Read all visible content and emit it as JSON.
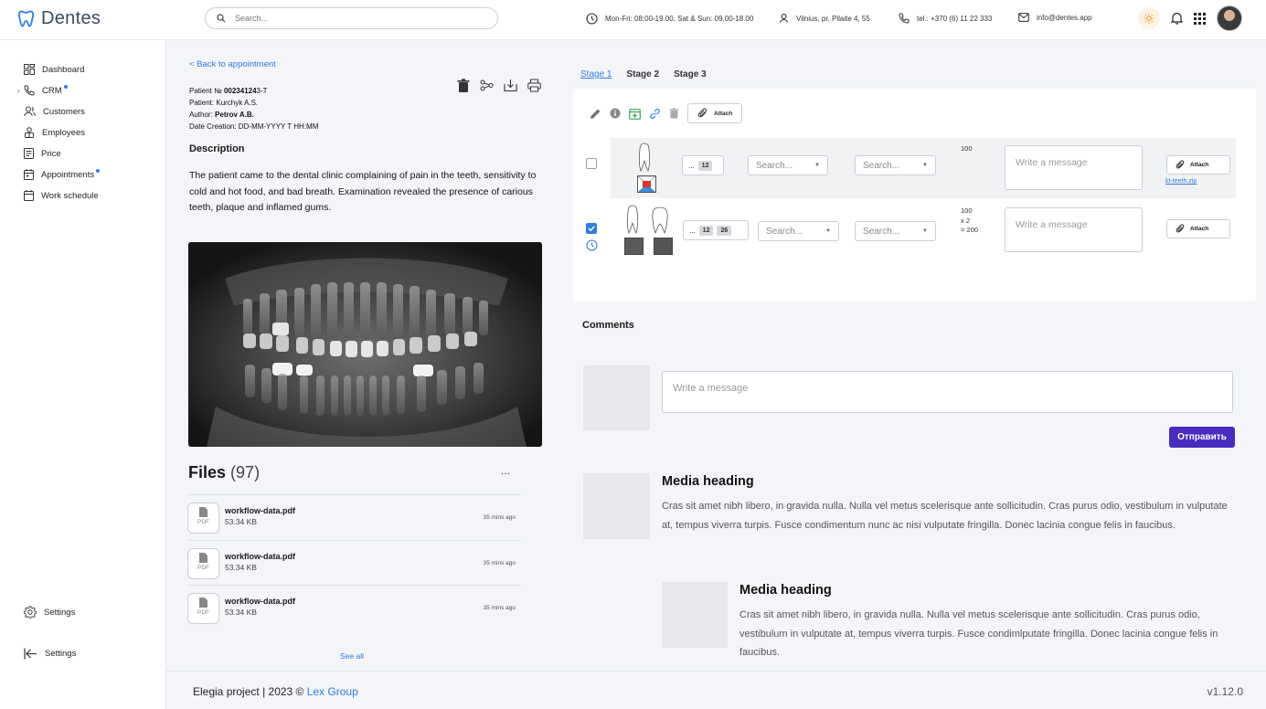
{
  "app": {
    "name": "Dentes"
  },
  "header": {
    "search_placeholder": "Search...",
    "hours": "Mon-Fri: 08:00-19.00, Sat & Sun: 09.00-18.00",
    "address": "Vilnius, pr. Pilaite 4, 55",
    "phone": "tel.: +370 (6) 11 22 333",
    "email": "info@dentes.app"
  },
  "sidebar": {
    "items": [
      {
        "label": "Dashboard",
        "icon": "dashboard-icon"
      },
      {
        "label": "CRM",
        "icon": "phone-icon",
        "dot": true
      },
      {
        "label": "Customers",
        "icon": "users-icon"
      },
      {
        "label": "Employees",
        "icon": "employees-icon"
      },
      {
        "label": "Price",
        "icon": "price-icon"
      },
      {
        "label": "Appointments",
        "icon": "calendar-icon",
        "dot": true
      },
      {
        "label": "Work schedule",
        "icon": "schedule-icon"
      }
    ],
    "settings_label": "Settings",
    "collapse_label": "Settings"
  },
  "record": {
    "back_label": "< Back to appointment",
    "patient_no_label": "Patient №",
    "patient_no_bold": "00234124",
    "patient_no_suffix": "3-T",
    "patient": "Patient: Kurchyk A.S.",
    "author_label": "Author:",
    "author_name": "Petrov A.B.",
    "date_creation": "Date Creation: DD-MM-YYYY T HH:MM",
    "description_title": "Description",
    "description_text": "The patient came to the dental clinic complaining of pain in the teeth, sensitivity to cold and hot food, and bad breath. Examination revealed the presence of carious teeth, plaque and inflamed gums."
  },
  "files": {
    "title": "Files",
    "count": "(97)",
    "more": "...",
    "items": [
      {
        "type": "PDF",
        "name": "workflow-data.pdf",
        "size": "53.34 KB",
        "time": "35 mins ago"
      },
      {
        "type": "PDF",
        "name": "workflow-data.pdf",
        "size": "53.34 KB",
        "time": "35 mins ago"
      },
      {
        "type": "PDF",
        "name": "workflow-data.pdf",
        "size": "53.34 KB",
        "time": "35 mins ago"
      }
    ],
    "see_all": "See all"
  },
  "stages": [
    "Stage 1",
    "Stage 2",
    "Stage 3"
  ],
  "panel": {
    "attach_label": "Attach",
    "rows": [
      {
        "checked": false,
        "dots": "...",
        "tags": [
          "12"
        ],
        "select1": "Search...",
        "select2": "Search...",
        "qty": [
          "100"
        ],
        "message_placeholder": "Write a message",
        "attach": "Attach",
        "file": "kt-teeth.zip"
      },
      {
        "checked": true,
        "dots": "...",
        "tags": [
          "12",
          "26"
        ],
        "select1": "Search...",
        "select2": "Search...",
        "qty": [
          "100",
          "x 2",
          "= 200"
        ],
        "message_placeholder": "Write a message",
        "attach": "Attach"
      }
    ]
  },
  "comments": {
    "title": "Comments",
    "input_placeholder": "Write a message",
    "send_label": "Отправить",
    "items": [
      {
        "heading": "Media heading",
        "text": "Cras sit amet nibh libero, in gravida nulla. Nulla vel metus scelerisque ante sollicitudin. Cras purus odio, vestibulum in vulputate at, tempus viverra turpis. Fusce condimentum nunc ac nisi vulputate fringilla. Donec lacinia congue felis in faucibus."
      },
      {
        "heading": "Media heading",
        "text": "Cras sit amet nibh libero, in gravida nulla. Nulla vel metus scelerisque ante sollicitudin. Cras purus odio, vestibulum in vulputate at, tempus viverra turpis. Fusce condimlputate fringilla. Donec lacinia congue felis in faucibus."
      }
    ]
  },
  "footer": {
    "project": "Elegia project",
    "copyright": "| 2023 ©",
    "company": "Lex Group",
    "version": "v1.12.0"
  },
  "colors": {
    "accent": "#2f7de1",
    "send": "#4a2bbf",
    "background": "#f3f5f8"
  }
}
